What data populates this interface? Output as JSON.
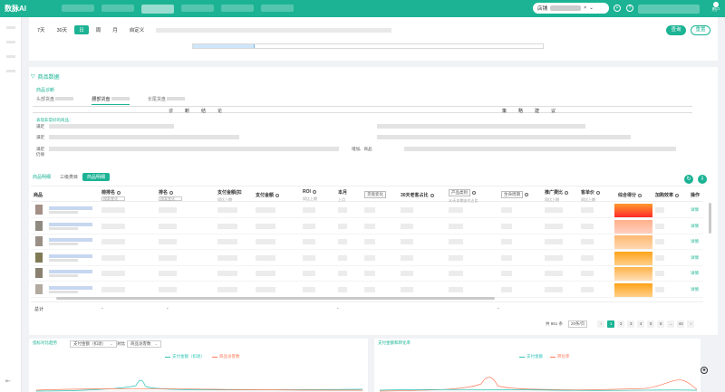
{
  "app": {
    "title": "数脉AI",
    "store_label": "店铺",
    "user_label": "用户"
  },
  "filter": {
    "date_tabs": [
      "7天",
      "30天",
      "日",
      "周",
      "月",
      "自定义"
    ],
    "active_tab": "日",
    "query_button": "查询",
    "reset_button": "重置"
  },
  "product": {
    "section_title": "商品数据",
    "diagnosis_title": "商品诊断",
    "subtabs": [
      "头部货盘",
      "腰部货盘",
      "长尾货盘"
    ],
    "active_subtab": "腰部货盘",
    "diag_header_1": "诊断结论",
    "diag_header_2": "策略建议",
    "focus_text": "表现非常好的商品：",
    "row_label": "满足",
    "row_label_4": "满足",
    "row_label_5": "仍保",
    "diag_extra": "增加、商品",
    "view_tabs": [
      "商品明细",
      "三级类目",
      "商品明细"
    ],
    "columns": {
      "product": "商品",
      "rank1": "榜排名",
      "rank1_input": "搜索变化",
      "rank2": "排名",
      "rank2_input": "搜索变化",
      "pay_a": "支付金额(扣",
      "pay_a_sub": "同比上期",
      "pay_b": "支付金额",
      "roi": "ROI",
      "roi_sub": "同比上期",
      "month": "本月",
      "month_sub": "上月",
      "change_sel": "货盘变化",
      "old_ratio": "30天老客占比",
      "category_sel": "产品类别",
      "category_sub": "30天本期支付占比",
      "lifecycle_sel": "生命周期",
      "promo": "推广费比",
      "promo_sub": "同比上期",
      "price": "客单价",
      "price_sub": "同比上期",
      "score": "综合得分",
      "efficiency": "加购效率",
      "action": "操作"
    },
    "detail_label": "详情",
    "total_label": "总计",
    "total_dash": "-",
    "pagination": {
      "total": "共 861 条",
      "page_size": "20条/页",
      "pages": [
        "1",
        "2",
        "3",
        "4",
        "5",
        "6",
        "...",
        "44"
      ],
      "active": "1",
      "prev": "‹",
      "next": "›"
    }
  },
  "charts": {
    "left": {
      "title": "指标对比趋势",
      "metric_a": "支付金额（扣退）",
      "compare_label": "对比",
      "metric_b": "商品访客数",
      "legend": [
        "支付金额（扣退）",
        "商品访客数"
      ]
    },
    "right": {
      "title": "支付金额和转化率",
      "legend": [
        "支付金额",
        "转化率"
      ]
    }
  },
  "colors": {
    "accent": "#1bb394",
    "score_orange": "#ffa31a",
    "score_red": "#ff2a2a",
    "legend_teal": "#2ec4b6",
    "legend_salmon": "#ff7b5c"
  }
}
